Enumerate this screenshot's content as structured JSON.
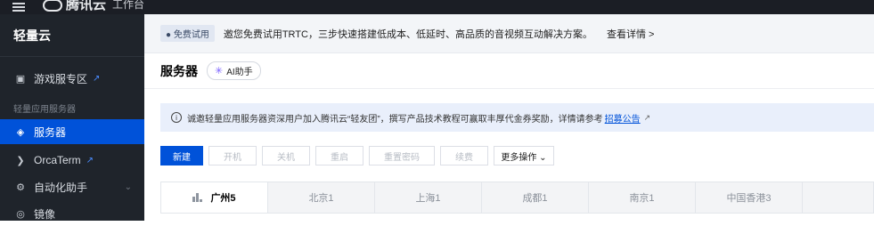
{
  "topbar": {
    "logo": "腾讯云",
    "crumb": "工作台"
  },
  "sidebar": {
    "title": "轻量云",
    "items": [
      {
        "label": "游戏服专区",
        "icon": "gamepad-icon"
      },
      {
        "label": "服务器",
        "icon": "server-icon"
      },
      {
        "label": "OrcaTerm",
        "icon": "terminal-icon"
      },
      {
        "label": "自动化助手",
        "icon": "automation-icon"
      },
      {
        "label": "镜像",
        "icon": "image-icon"
      }
    ],
    "group_label": "轻量应用服务器"
  },
  "notice": {
    "badge": "● 免费试用",
    "text": "邀您免费试用TRTC，三步快速搭建低成本、低延时、高品质的音视频互动解决方案。",
    "link": "查看详情 >"
  },
  "page": {
    "title": "服务器",
    "ai_label": "AI助手"
  },
  "info": {
    "text": "诚邀轻量应用服务器资深用户加入腾讯云“轻友团”，撰写产品技术教程可赢取丰厚代金券奖励，详情请参考",
    "link": "招募公告"
  },
  "toolbar": {
    "buttons": [
      {
        "label": "新建"
      },
      {
        "label": "开机"
      },
      {
        "label": "关机"
      },
      {
        "label": "重启"
      },
      {
        "label": "重置密码"
      },
      {
        "label": "续费"
      },
      {
        "label": "更多操作 ⌄"
      }
    ]
  },
  "regions": [
    {
      "label": "广州5"
    },
    {
      "label": "北京1"
    },
    {
      "label": "上海1"
    },
    {
      "label": "成都1"
    },
    {
      "label": "南京1"
    },
    {
      "label": "中国香港3"
    }
  ],
  "colors": {
    "primary": "#0052d9",
    "sidebar_bg": "#1f242b",
    "topbar_bg": "#1b1e25"
  }
}
